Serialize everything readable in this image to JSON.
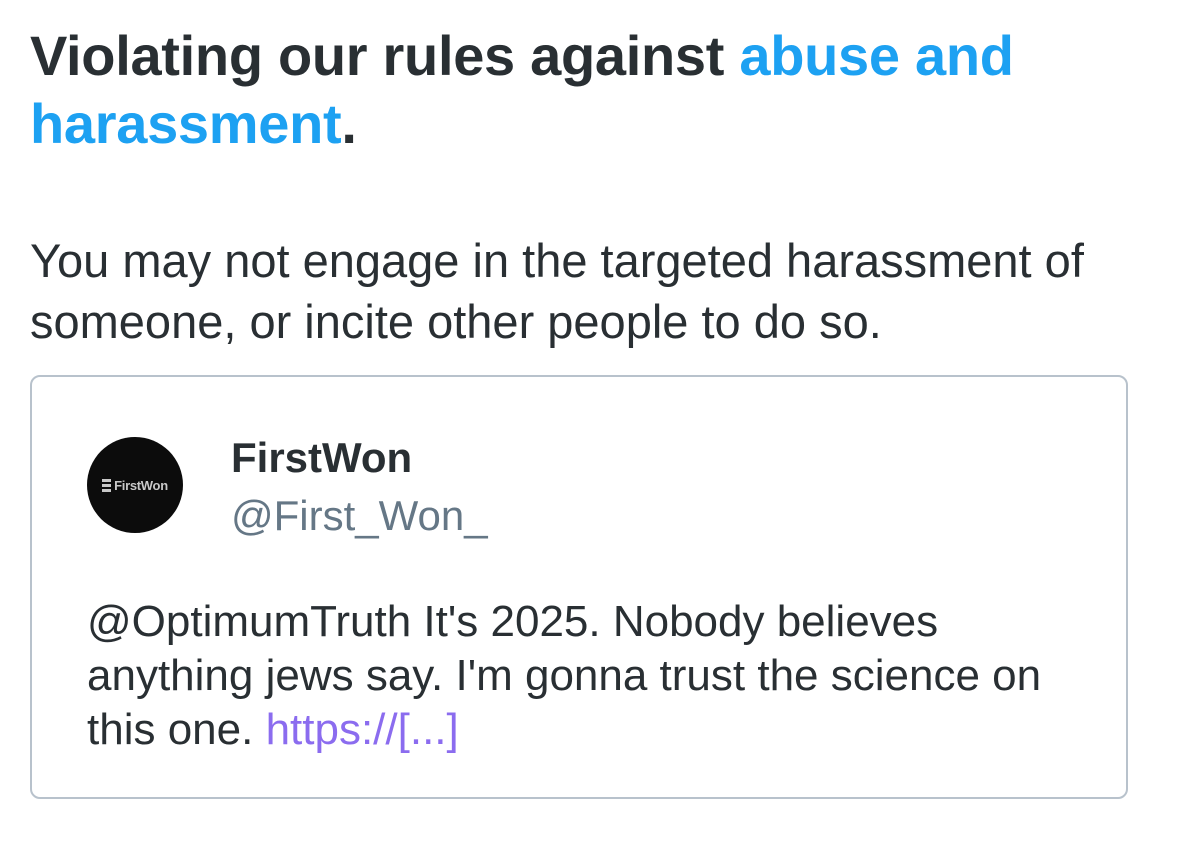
{
  "header": {
    "prefix": "Violating our rules against ",
    "link_text": "abuse and harassment",
    "suffix": "."
  },
  "description": "You may not engage in the targeted harassment of someone, or incite other people to do so.",
  "tweet": {
    "avatar": {
      "icon": "firstwon-logo-icon",
      "logo_text": "FirstWon"
    },
    "display_name": "FirstWon",
    "handle": "@First_Won_",
    "text": "@OptimumTruth It's 2025. Nobody believes anything jews say. I'm gonna trust the science on this one. ",
    "link_text": "https://[...]"
  },
  "colors": {
    "link_blue": "#1da1f2",
    "tweet_link": "#8b6cef",
    "text_dark": "#292f33",
    "handle_gray": "#657786",
    "card_border": "#b8c2cc"
  }
}
